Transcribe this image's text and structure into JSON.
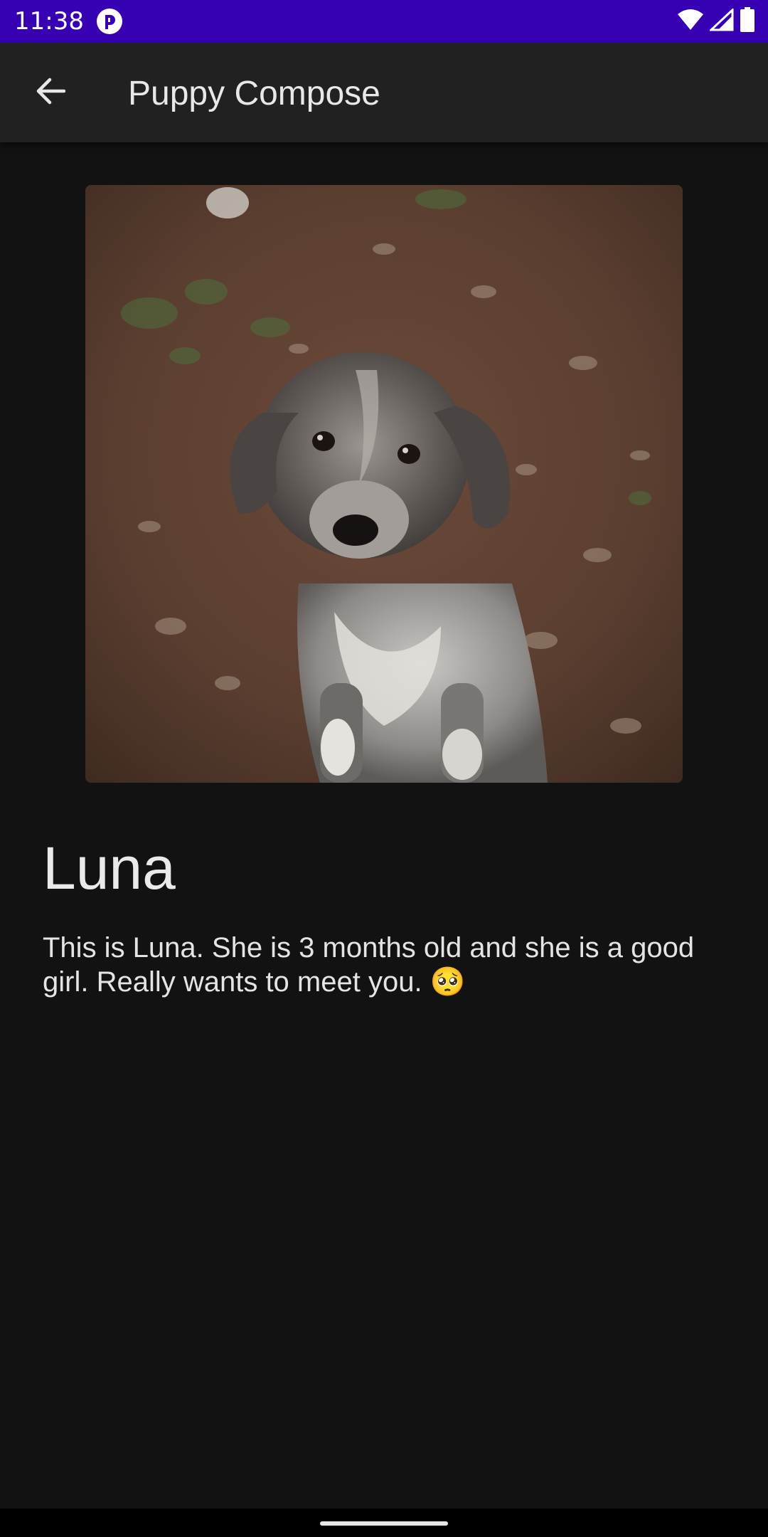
{
  "status_bar": {
    "time": "11:38",
    "notification_icon": "app-notification-icon",
    "icons": [
      "wifi-icon",
      "signal-icon",
      "battery-icon"
    ],
    "background": "#3700b3"
  },
  "app_bar": {
    "title": "Puppy Compose",
    "back_icon": "arrow-back-icon",
    "background": "#212121"
  },
  "puppy": {
    "image_icon": "puppy-photo",
    "name": "Luna",
    "description": "This is Luna. She is 3 months old and she is a good girl. Really wants to meet you. 🥺"
  },
  "theme": {
    "background": "#121212",
    "text": "#e6e6e6"
  }
}
